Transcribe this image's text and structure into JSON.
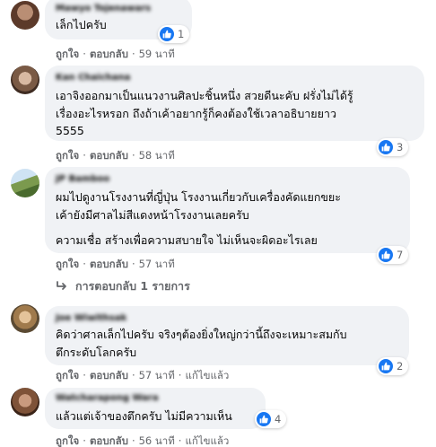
{
  "colors": {
    "bubble": "#f0f2f5",
    "meta": "#65676b",
    "like": "#1877f2"
  },
  "icons": {
    "like": "thumbs-up-icon",
    "reply_arrow": "reply-arrow-icon"
  },
  "comments": [
    {
      "author": "Mawyo Tojenawars",
      "lines": [
        "เล็กไปครับ"
      ],
      "like": "ถูกใจ",
      "reply": "ตอบกลับ",
      "time": "59 นาที",
      "edited": "",
      "reactions": "1"
    },
    {
      "author": "Kan Chaichana",
      "lines": [
        "เอาจิงออกมาเป็นแนวงานศิลปะชิ้นหนึ่ง สวยดีนะคับ ฝรั่งไม่ได้รู้",
        "เรื่องอะไรหรอก ถึงถ้าเค้าอยากรู้ก็คงต้องใช้เวลาอธิบายยาว",
        "5555"
      ],
      "like": "ถูกใจ",
      "reply": "ตอบกลับ",
      "time": "58 นาที",
      "edited": "",
      "reactions": "3"
    },
    {
      "author": "JP Bamboo",
      "lines": [
        "ผมไปดูงานโรงงานที่ญี่ปุ่น โรงงานเกี่ยวกับเครื่องคัดแยกขยะ",
        "เค้ายังมีศาลไม่สีแดงหน้าโรงงานเลยครับ",
        "ความเชื่อ สร้างเพื่อความสบายใจ ไม่เห็นจะผิดอะไรเลย"
      ],
      "like": "ถูกใจ",
      "reply": "ตอบกลับ",
      "time": "57 นาที",
      "edited": "",
      "reactions": "7",
      "replies_link": "การตอบกลับ 1 รายการ"
    },
    {
      "author": "Joe Wiwithsak",
      "lines": [
        "คิดว่าศาลเล็กไปครับ จริงๆต้องยิ่งใหญ่กว่านี้ถึงจะเหมาะสมกับ",
        "ตึกระดับโลกครับ"
      ],
      "like": "ถูกใจ",
      "reply": "ตอบกลับ",
      "time": "57 นาที",
      "edited": "แก้ไขแล้ว",
      "reactions": "2"
    },
    {
      "author": "Watcharapong Wara",
      "lines": [
        "แล้วแต่เจ้าของตึกครับ ไม่มีความเห็น"
      ],
      "like": "ถูกใจ",
      "reply": "ตอบกลับ",
      "time": "56 นาที",
      "edited": "แก้ไขแล้ว",
      "reactions": "4"
    }
  ]
}
